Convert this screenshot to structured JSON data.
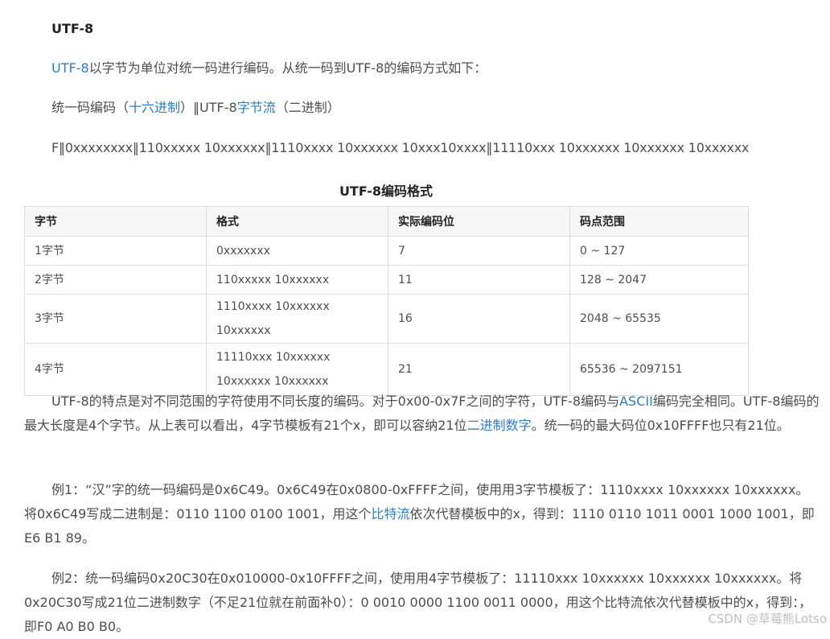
{
  "heading": "UTF-8",
  "intro": {
    "link": "UTF-8",
    "rest": "以字节为单位对统一码进行编码。从统一码到UTF-8的编码方式如下："
  },
  "mapping_line": {
    "pre": "统一码编码（",
    "link1": "十六进制",
    "mid": "）‖UTF-8",
    "link2": "字节流",
    "post": "（二进制）"
  },
  "format_line": "F‖0xxxxxxxx‖110xxxxx 10xxxxxx‖1110xxxx 10xxxxxx 10xxx10xxxx‖11110xxx 10xxxxxx 10xxxxxx 10xxxxxx",
  "table": {
    "caption": "UTF-8编码格式",
    "headers": [
      "字节",
      "格式",
      "实际编码位",
      "码点范围"
    ],
    "rows": [
      [
        "1字节",
        "0xxxxxxx",
        "7",
        "0 ~ 127"
      ],
      [
        "2字节",
        "110xxxxx 10xxxxxx",
        "11",
        "128 ~ 2047"
      ],
      [
        "3字节",
        "1110xxxx 10xxxxxx 10xxxxxx",
        "16",
        "2048 ~ 65535"
      ],
      [
        "4字节",
        "11110xxx 10xxxxxx 10xxxxxx 10xxxxxx",
        "21",
        "65536 ~ 2097151"
      ]
    ]
  },
  "para1": {
    "t1": "UTF-8的特点是对不同范围的字符使用不同长度的编码。对于0x00-0x7F之间的字符，UTF-8编码与",
    "link1": "ASCII",
    "t2": "编码完全相同。UTF-8编码的最大长度是4个字节。从上表可以看出，4字节模板有21个x，即可以容纳21位",
    "link2": "二进制数字",
    "t3": "。统一码的最大码位0x10FFFF也只有21位。"
  },
  "para2": {
    "t1": "例1：“汉”字的统一码编码是0x6C49。0x6C49在0x0800-0xFFFF之间，使用用3字节模板了：1110xxxx 10xxxxxx 10xxxxxx。将0x6C49写成二进制是：0110 1100 0100 1001，用这个",
    "link": "比特流",
    "t2": "依次代替模板中的x，得到：1110 0110 1011 0001 1000 1001，即E6 B1 89。"
  },
  "para3": {
    "text": "例2：统一码编码0x20C30在0x010000-0x10FFFF之间，使用用4字节模板了：11110xxx 10xxxxxx 10xxxxxx 10xxxxxx。将0x20C30写成21位二进制数字（不足21位就在前面补0）：0 0010 0000 1100 0011 0000，用这个比特流依次代替模板中的x，得到：，即F0 A0 B0 B0。"
  },
  "watermark": "CSDN @草莓熊Lotso",
  "colors": {
    "link": "#2a7ec4",
    "text": "#4d4d4d",
    "heading": "#222222",
    "table_border": "#dddddd"
  }
}
